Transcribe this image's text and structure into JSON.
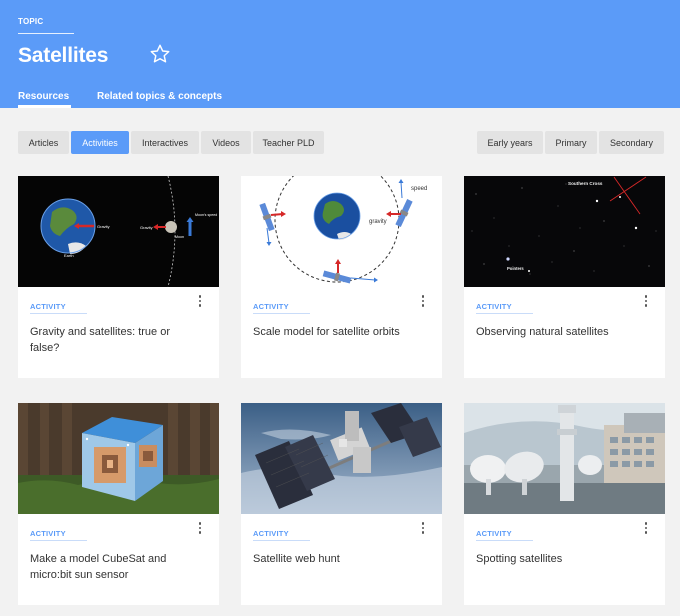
{
  "header": {
    "topic_label": "TOPIC",
    "title": "Satellites",
    "favorite_icon": "star-outline-icon",
    "tabs": [
      {
        "label": "Resources",
        "active": true
      },
      {
        "label": "Related topics & concepts",
        "active": false
      }
    ]
  },
  "filters": {
    "type_buttons": [
      {
        "label": "Articles",
        "active": false
      },
      {
        "label": "Activities",
        "active": true
      },
      {
        "label": "Interactives",
        "active": false
      },
      {
        "label": "Videos",
        "active": false
      },
      {
        "label": "Teacher PLD",
        "active": false
      }
    ],
    "level_buttons": [
      {
        "label": "Early years",
        "active": false
      },
      {
        "label": "Primary",
        "active": false
      },
      {
        "label": "Secondary",
        "active": false
      }
    ]
  },
  "cards": [
    {
      "tag": "ACTIVITY",
      "title": "Gravity and satellites: true or false?",
      "image_labels": [
        "Gravity",
        "Earth",
        "Gravity",
        "Moon's speed",
        "Moon"
      ]
    },
    {
      "tag": "ACTIVITY",
      "title": "Scale model for satellite orbits",
      "image_labels": [
        "speed",
        "gravity"
      ]
    },
    {
      "tag": "ACTIVITY",
      "title": "Observing natural satellites",
      "image_labels": [
        "Southern Cross",
        "Pointers"
      ]
    },
    {
      "tag": "ACTIVITY",
      "title": "Make a model CubeSat and micro:bit sun sensor"
    },
    {
      "tag": "ACTIVITY",
      "title": "Satellite web hunt"
    },
    {
      "tag": "ACTIVITY",
      "title": "Spotting satellites"
    }
  ],
  "colors": {
    "accent": "#5b9bf8",
    "page_bg": "#f2f2f2",
    "card_bg": "#ffffff"
  }
}
